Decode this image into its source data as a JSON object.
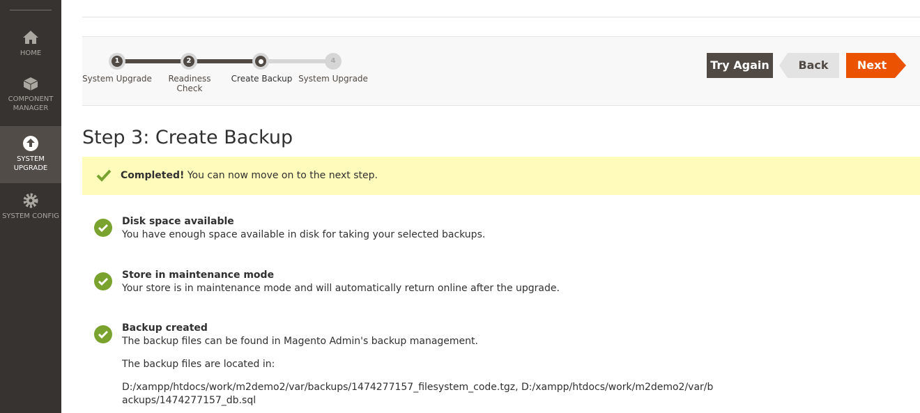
{
  "sidebar": {
    "items": [
      {
        "label": "HOME",
        "icon": "home-icon"
      },
      {
        "label": "COMPONENT MANAGER",
        "icon": "component-icon"
      },
      {
        "label": "SYSTEM UPGRADE",
        "icon": "upgrade-icon",
        "active": true
      },
      {
        "label": "SYSTEM CONFIG",
        "icon": "gear-icon"
      }
    ]
  },
  "progress": {
    "steps": [
      {
        "num": "1",
        "label": "System Upgrade"
      },
      {
        "num": "2",
        "label": "Readiness Check"
      },
      {
        "num": "",
        "label": "Create Backup",
        "current": true
      },
      {
        "num": "4",
        "label": "System Upgrade"
      }
    ]
  },
  "actions": {
    "try_again": "Try Again",
    "back": "Back",
    "next": "Next"
  },
  "page_title": "Step 3: Create Backup",
  "message": {
    "strong": "Completed!",
    "text": " You can now move on to the next step."
  },
  "checks": [
    {
      "title": "Disk space available",
      "desc": "You have enough space available in disk for taking your selected backups."
    },
    {
      "title": "Store in maintenance mode",
      "desc": "Your store is in maintenance mode and will automatically return online after the upgrade."
    },
    {
      "title": "Backup created",
      "desc": "The backup files can be found in Magento Admin's backup management.",
      "extra": "The backup files are located in:",
      "paths": "D:/xampp/htdocs/work/m2demo2/var/backups/1474277157_filesystem_code.tgz, D:/xampp/htdocs/work/m2demo2/var/backups/1474277157_db.sql"
    }
  ],
  "colors": {
    "accent": "#eb5202",
    "success": "#79a22e",
    "sidebar": "#373330"
  }
}
